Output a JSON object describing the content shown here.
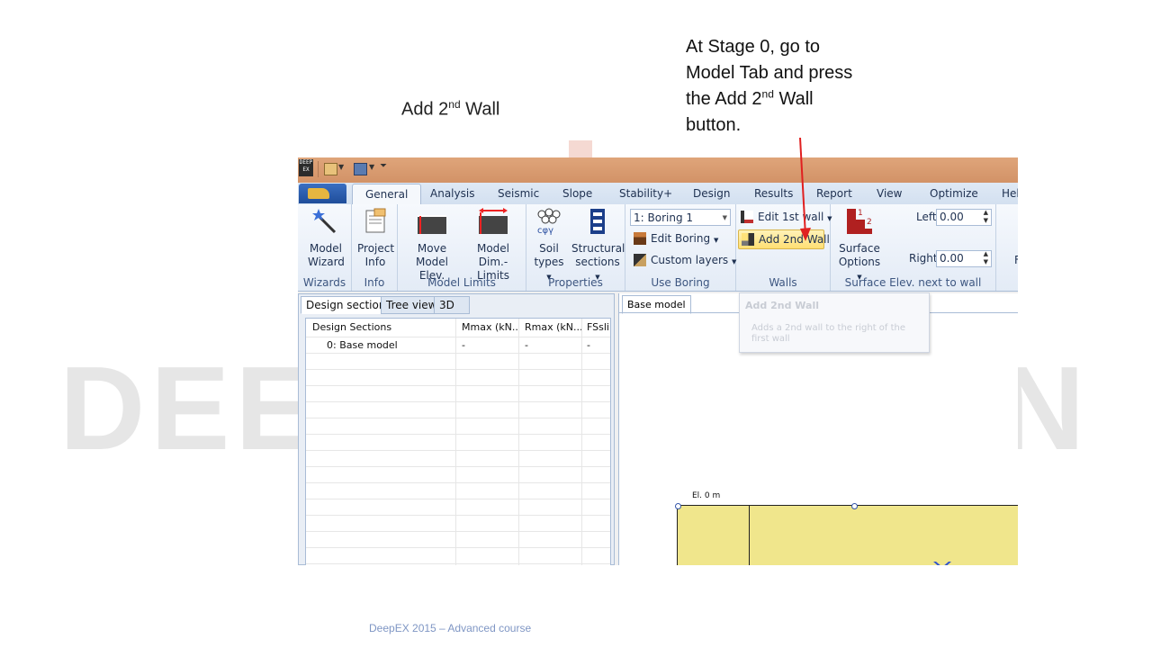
{
  "slide": {
    "title_main": "Add 2",
    "title_sup": "nd",
    "title_end": " Wall",
    "instruction_main": "At Stage 0, go to Model Tab and press the Add 2",
    "instruction_sup": "nd",
    "instruction_end": " Wall button.",
    "footer": "DeepEX 2015 – Advanced course",
    "watermark_left": "DEE",
    "watermark_right": "N"
  },
  "app": {
    "logo": "DEEP EX",
    "tabs": [
      "General",
      "Analysis",
      "Seismic",
      "Slope",
      "Stability+",
      "Design",
      "Results",
      "Report",
      "View",
      "Optimize",
      "Hel"
    ],
    "active_tab": "General",
    "ribbon": {
      "wizards": {
        "label": "Wizards",
        "model_wizard": "Model Wizard"
      },
      "info": {
        "label": "Info",
        "project_info": "Project Info"
      },
      "model_limits": {
        "label": "Model Limits",
        "move_model_elev": "Move Model Elev.",
        "model_dim_limits": "Model Dim.-Limits"
      },
      "properties": {
        "label": "Properties",
        "soil_types": "Soil types",
        "structural_sections": "Structural sections"
      },
      "use_boring": {
        "label": "Use Boring",
        "boring_select": "1: Boring 1",
        "edit_boring": "Edit Boring",
        "custom_layers": "Custom layers"
      },
      "walls": {
        "label": "Walls",
        "edit_1st_wall": "Edit 1st wall",
        "add_2nd_wall": "Add 2nd Wall"
      },
      "surface": {
        "label": "Surface Elev. next to wall",
        "surface_options": "Surface Options",
        "left_label": "Left",
        "left_value": "0.00",
        "right_label": "Right",
        "right_value": "0.00",
        "cut_letter": "F"
      }
    },
    "left_panel": {
      "tabs": [
        "Design sections",
        "Tree view",
        "3D"
      ],
      "columns": [
        "Design Sections",
        "Mmax (kN...",
        "Rmax (kN...",
        "FSsli"
      ],
      "rows": [
        [
          "0: Base model",
          "-",
          "-",
          "-"
        ]
      ]
    },
    "right_panel": {
      "tab": "Base model",
      "tooltip_title": "Add 2nd Wall",
      "tooltip_body": "Adds a 2nd wall to the right of the first wall",
      "elevation_label": "El. 0 m"
    }
  },
  "colors": {
    "qat": "#d8996c",
    "ribbon_tab_text": "#1e3050",
    "highlight": "#ffdf73",
    "soil": "#f0e68c",
    "arrow": "#e02020",
    "footer": "#7f96c4"
  }
}
